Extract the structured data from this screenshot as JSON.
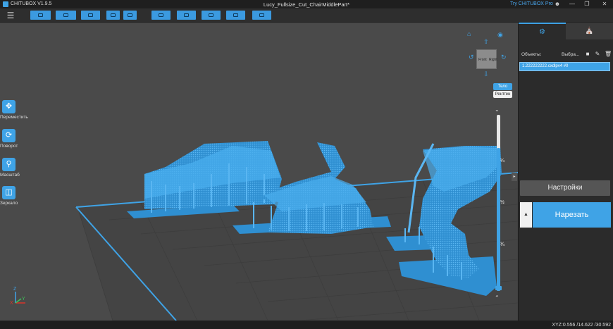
{
  "titlebar": {
    "app_name": "CHITUBOX V1.9.5",
    "document_title": "Lucy_Fullsize_Cut_ChairMiddlePart*",
    "try_pro": "Try CHITUBOX Pro",
    "user_icon": "user-icon",
    "min_icon": "minimize-icon",
    "restore_icon": "restore-icon",
    "close_icon": "close-icon"
  },
  "toolbar": {
    "menu_icon": "hamburger-menu-icon",
    "buttons": [
      "open-file-icon",
      "save-file-icon",
      "import-icon",
      "undo-icon",
      "redo-icon",
      "screenshot-icon",
      "support-tree-icon",
      "light-icon",
      "layer-icon",
      "export-icon"
    ]
  },
  "left_tools": [
    {
      "label": "Переместить",
      "icon": "move-icon"
    },
    {
      "label": "Поворот",
      "icon": "rotate-icon"
    },
    {
      "label": "Масштаб",
      "icon": "scale-icon"
    },
    {
      "label": "Зеркало",
      "icon": "mirror-icon"
    }
  ],
  "view_modes": {
    "active": "Тело",
    "inactive": "Рентген"
  },
  "slider": {
    "top_tick": "¼",
    "mid_tick": "½",
    "low_tick": "¾",
    "fraction_filled": 0.81
  },
  "navcube": {
    "left_face": "Front",
    "right_face": "Right"
  },
  "status": {
    "xyz": "XYZ:0.556 /14.622 /30.592"
  },
  "panel": {
    "tab_active_icon": "gear-settings-icon",
    "tab_inactive_icon": "building-icon",
    "objects_label": "Объекты:",
    "select_label": "Выбра...",
    "file_item": "1.222222222.cxdlpv4 #0",
    "settings_label": "Настройки",
    "slice_label": "Нарезать",
    "slice_plus": "▲"
  },
  "colors": {
    "accent": "#3fa3e6",
    "viewport": "#4a4a4a",
    "panel": "#2b2b2b"
  }
}
